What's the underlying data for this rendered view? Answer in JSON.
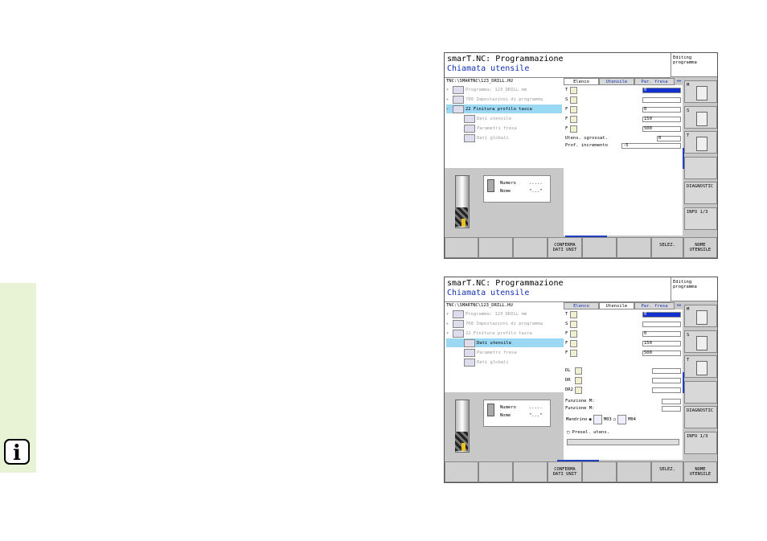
{
  "side_strip": {
    "info_glyph": "i",
    "color": "#e8f2d4"
  },
  "screens": [
    {
      "title": "smarT.NC: Programmazione",
      "subtitle": "Chiamata utensile",
      "mode": [
        "Editing",
        "programma"
      ],
      "path": "TNC:\\SMARTNC\\123_DRILL.HU",
      "tree": [
        {
          "exp": "▾",
          "label": "Programma: 123_DRILL mm",
          "sel": false
        },
        {
          "exp": "▸",
          "label": "700 Impostazioni di programma",
          "sel": false
        },
        {
          "exp": "▾",
          "label": "22 Finitura profilo tasca",
          "sel": true
        },
        {
          "exp": "",
          "label": "Dati utensile",
          "sel": false
        },
        {
          "exp": "",
          "label": "Parametri fresa",
          "sel": false
        },
        {
          "exp": "",
          "label": "Dati globali",
          "sel": false
        }
      ],
      "preview": {
        "rows": [
          {
            "label": "Numero",
            "value": "....."
          },
          {
            "label": "Nome",
            "value": "\"...\""
          }
        ]
      },
      "tabs": [
        {
          "label": "Elenco",
          "active": true
        },
        {
          "label": "Utensile",
          "active": false
        },
        {
          "label": "Par. fresa",
          "active": false
        }
      ],
      "tab_arrow": "◂▸",
      "fields": [
        {
          "label": "T",
          "value": "0",
          "hl": true
        },
        {
          "label": "S",
          "value": "",
          "hl": false
        },
        {
          "label": "F",
          "value": "0",
          "hl": false
        },
        {
          "label": "F",
          "value": "150",
          "hl": false
        },
        {
          "label": "F",
          "value": "500",
          "hl": false
        }
      ],
      "text_rows": [
        {
          "label": "Utens. sgrossat.",
          "value": "0"
        },
        {
          "label": "Prof. incremento",
          "value": "-5"
        }
      ],
      "right_buttons": [
        "M",
        "S",
        "T",
        "",
        "DIAGNOSTIC",
        "INFO 1/3"
      ],
      "softkeys": [
        "",
        "",
        "",
        "CONFERMA\nDATI UNIT",
        "",
        "",
        "SELEZ.",
        "NOME\nUTENSILE"
      ]
    },
    {
      "title": "smarT.NC: Programmazione",
      "subtitle": "Chiamata utensile",
      "mode": [
        "Editing",
        "programma"
      ],
      "path": "TNC:\\SMARTNC\\123_DRILL.HU",
      "tree": [
        {
          "exp": "▾",
          "label": "Programma: 123_DRILL mm",
          "sel": false
        },
        {
          "exp": "▸",
          "label": "700 Impostazioni di programma",
          "sel": false
        },
        {
          "exp": "▾",
          "label": "22 Finitura profilo tasca",
          "sel": false
        },
        {
          "exp": "",
          "label": "Dati utensile",
          "sel": true
        },
        {
          "exp": "",
          "label": "Parametri fresa",
          "sel": false
        },
        {
          "exp": "",
          "label": "Dati globali",
          "sel": false
        }
      ],
      "preview": {
        "rows": [
          {
            "label": "Numero",
            "value": "....."
          },
          {
            "label": "Nome",
            "value": "\"...\""
          }
        ]
      },
      "tabs": [
        {
          "label": "Elenco",
          "active": false
        },
        {
          "label": "Utensile",
          "active": true
        },
        {
          "label": "Par. fresa",
          "active": false
        }
      ],
      "tab_arrow": "◂▸",
      "fields": [
        {
          "label": "T",
          "value": "0",
          "hl": true
        },
        {
          "label": "S",
          "value": "",
          "hl": false
        },
        {
          "label": "F",
          "value": "0",
          "hl": false
        },
        {
          "label": "F",
          "value": "150",
          "hl": false
        },
        {
          "label": "F",
          "value": "500",
          "hl": false
        }
      ],
      "offset_fields": [
        {
          "label": "DL",
          "value": ""
        },
        {
          "label": "DR",
          "value": ""
        },
        {
          "label": "DR2",
          "value": ""
        }
      ],
      "m_rows": [
        {
          "label": "Funzione M:",
          "value": ""
        },
        {
          "label": "Funzione M:",
          "value": ""
        }
      ],
      "spindle": {
        "label": "Mandrino",
        "opt1": "M03",
        "opt2": "M04"
      },
      "preselect": "Presel. utens.",
      "right_buttons": [
        "M",
        "S",
        "T",
        "",
        "DIAGNOSTIC",
        "INFO 1/3"
      ],
      "softkeys": [
        "",
        "",
        "",
        "CONFERMA\nDATI UNIT",
        "",
        "",
        "SELEZ.",
        "NOME\nUTENSILE"
      ]
    }
  ]
}
